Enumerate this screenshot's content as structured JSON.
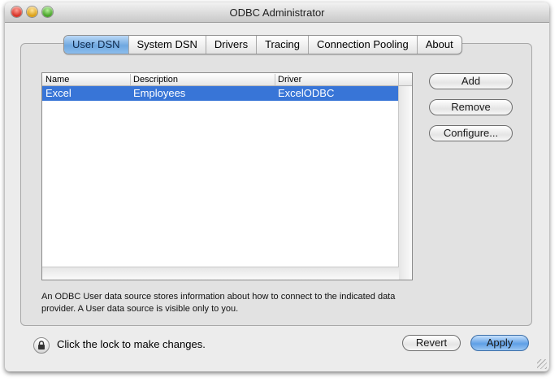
{
  "window": {
    "title": "ODBC Administrator"
  },
  "tabs": [
    {
      "label": "User DSN",
      "active": true
    },
    {
      "label": "System DSN"
    },
    {
      "label": "Drivers"
    },
    {
      "label": "Tracing"
    },
    {
      "label": "Connection Pooling"
    },
    {
      "label": "About"
    }
  ],
  "table": {
    "columns": [
      "Name",
      "Description",
      "Driver"
    ],
    "rows": [
      {
        "name": "Excel",
        "description": "Employees",
        "driver": "ExcelODBC",
        "selected": true
      }
    ]
  },
  "buttons": {
    "add": "Add",
    "remove": "Remove",
    "configure": "Configure...",
    "revert": "Revert",
    "apply": "Apply"
  },
  "description": "An ODBC User data source stores information about how to connect to the indicated data provider. A User data source is visible only to you.",
  "lock": {
    "text": "Click the lock to make changes.",
    "icon": "lock-icon"
  },
  "colors": {
    "selection": "#3875d7",
    "accent": "#5f9fe6"
  }
}
